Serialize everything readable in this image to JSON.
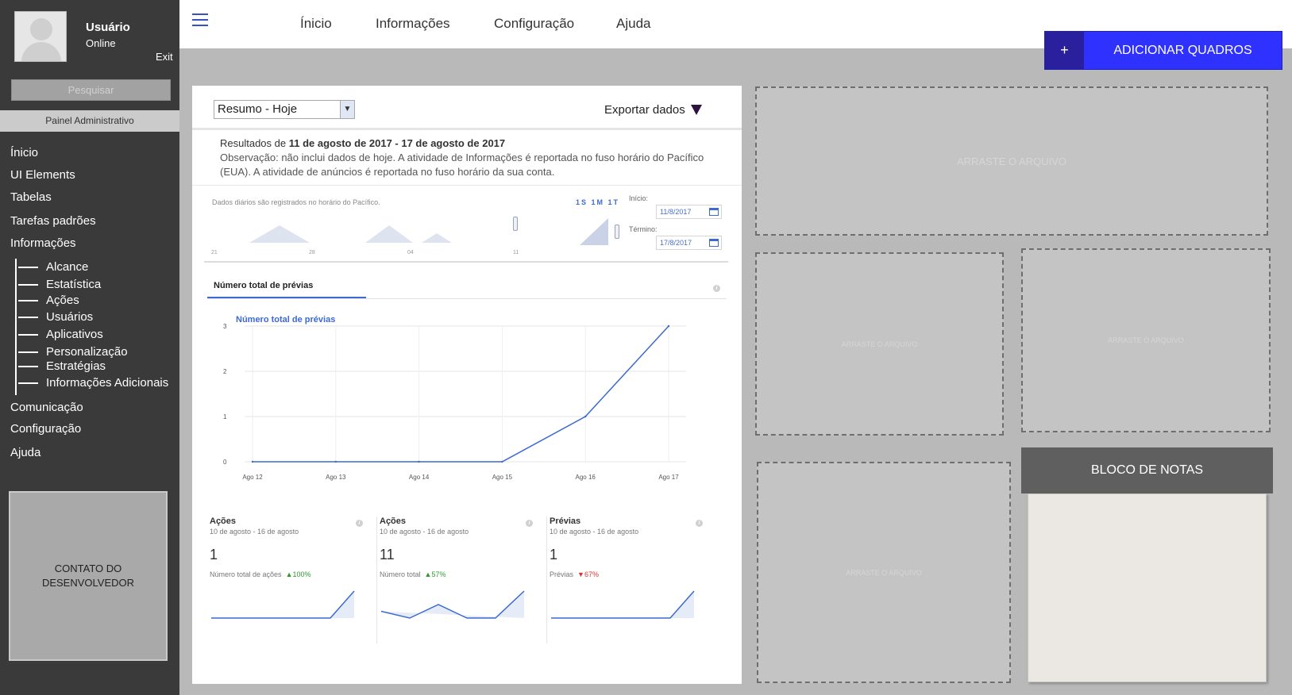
{
  "sidebar": {
    "user_name": "Usuário",
    "user_status": "Online",
    "exit_label": "Exit",
    "search_placeholder": "Pesquisar",
    "panel_title": "Painel Administrativo",
    "nav": [
      "Ínicio",
      "UI Elements",
      "Tabelas",
      "Tarefas padrões",
      "Informações"
    ],
    "sub_items": [
      "Alcance",
      "Estatística",
      "Ações",
      "Usuários",
      "Aplicativos",
      "Personalização",
      "Estratégias",
      "Informações Adicionais"
    ],
    "nav_bottom": [
      "Comunicação",
      "Configuração",
      "Ajuda"
    ],
    "dev_contact": "CONTATO DO DESENVOLVEDOR"
  },
  "topbar": {
    "links": [
      "Ínicio",
      "Informações",
      "Configuração",
      "Ajuda"
    ]
  },
  "add_button": {
    "icon": "+",
    "label": "ADICIONAR QUADROS"
  },
  "card": {
    "select_value": "Resumo - Hoje",
    "export_label": "Exportar dados",
    "results_prefix": "Resultados de ",
    "results_range": "11 de agosto de 2017 - 17 de agosto de 2017",
    "results_note": "Observação: não inclui dados de hoje. A atividade de Informações é reportada no fuso horário do Pacífico (EUA). A atividade de anúncios é reportada no fuso horário da sua conta.",
    "timeline": {
      "note": "Dados diários são registrados no horário do Pacífico.",
      "range_buttons": "1S 1M 1T",
      "start_label": "Início:",
      "start_value": "11/8/2017",
      "end_label": "Término:",
      "end_value": "17/8/2017",
      "ticks": [
        "21",
        "28",
        "04",
        "11"
      ]
    },
    "tab_label": "Número total de prévias",
    "info_glyph": "i"
  },
  "chart_data": {
    "type": "line",
    "title": "Número total de prévias",
    "categories": [
      "Ago 12",
      "Ago 13",
      "Ago 14",
      "Ago 15",
      "Ago 16",
      "Ago 17"
    ],
    "values": [
      0,
      0,
      0,
      0,
      1,
      3
    ],
    "ylim": [
      0,
      3
    ],
    "yticks": [
      0,
      1,
      2,
      3
    ],
    "grid": true,
    "color": "#3c6ad0"
  },
  "mini_cards": [
    {
      "title": "Ações",
      "subtitle": "10 de agosto - 16 de agosto",
      "value": "1",
      "label": "Número total de ações",
      "change": "100%",
      "trend": "up",
      "spark": [
        0,
        0,
        0,
        0,
        0,
        0,
        1
      ]
    },
    {
      "title": "Ações",
      "subtitle": "10 de agosto - 16 de agosto",
      "value": "11",
      "label": "Número total",
      "change": "57%",
      "trend": "up",
      "spark": [
        1,
        0,
        2,
        0,
        0,
        4
      ]
    },
    {
      "title": "Prévias",
      "subtitle": "10 de agosto - 16 de agosto",
      "value": "1",
      "label": "Prévias",
      "change": "67%",
      "trend": "down",
      "spark": [
        0,
        0,
        0,
        0,
        0,
        0,
        1
      ]
    }
  ],
  "drop_zones": {
    "label": "ARRASTE O ARQUIVO"
  },
  "notes": {
    "title": "BLOCO DE NOTAS"
  },
  "colors": {
    "sidebar": "#3a3a3a",
    "accent": "#2f31ff",
    "chart_line": "#3c6ad0",
    "background": "#b9b9b9"
  }
}
